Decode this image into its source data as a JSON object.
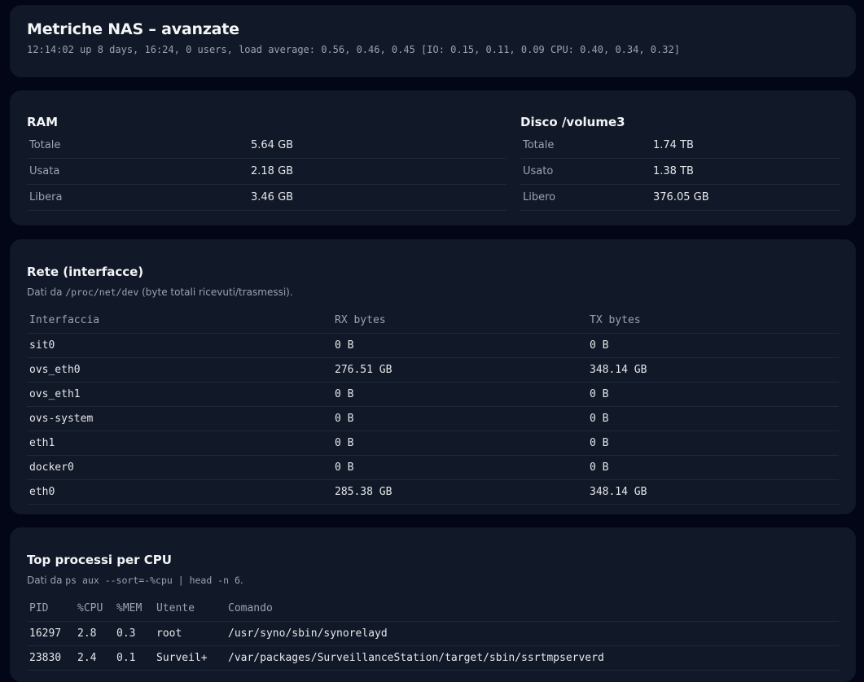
{
  "header": {
    "title": "Metriche NAS – avanzate",
    "uptime": "12:14:02 up 8 days, 16:24, 0 users, load average: 0.56, 0.46, 0.45 [IO: 0.15, 0.11, 0.09 CPU: 0.40, 0.34, 0.32]"
  },
  "ram": {
    "title": "RAM",
    "rows": [
      {
        "label": "Totale",
        "value": "5.64 GB"
      },
      {
        "label": "Usata",
        "value": "2.18 GB"
      },
      {
        "label": "Libera",
        "value": "3.46 GB"
      }
    ]
  },
  "disk": {
    "title": "Disco /volume3",
    "rows": [
      {
        "label": "Totale",
        "value": "1.74 TB"
      },
      {
        "label": "Usato",
        "value": "1.38 TB"
      },
      {
        "label": "Libero",
        "value": "376.05 GB"
      }
    ]
  },
  "network": {
    "title": "Rete (interfacce)",
    "subtitle_prefix": "Dati da",
    "subtitle_code": "/proc/net/dev",
    "subtitle_suffix": "(byte totali ricevuti/trasmessi).",
    "headers": [
      "Interfaccia",
      "RX bytes",
      "TX bytes"
    ],
    "rows": [
      [
        "sit0",
        "0 B",
        "0 B"
      ],
      [
        "ovs_eth0",
        "276.51 GB",
        "348.14 GB"
      ],
      [
        "ovs_eth1",
        "0 B",
        "0 B"
      ],
      [
        "ovs-system",
        "0 B",
        "0 B"
      ],
      [
        "eth1",
        "0 B",
        "0 B"
      ],
      [
        "docker0",
        "0 B",
        "0 B"
      ],
      [
        "eth0",
        "285.38 GB",
        "348.14 GB"
      ]
    ]
  },
  "processes": {
    "title": "Top processi per CPU",
    "subtitle_prefix": "Dati da",
    "subtitle_code": "ps aux --sort=-%cpu | head -n 6",
    "subtitle_suffix": ".",
    "headers": [
      "PID",
      "%CPU",
      "%MEM",
      "Utente",
      "Comando"
    ],
    "rows": [
      [
        "16297",
        "2.8",
        "0.3",
        "root",
        "/usr/syno/sbin/synorelayd"
      ],
      [
        "23830",
        "2.4",
        "0.1",
        "Surveil+",
        "/var/packages/SurveillanceStation/target/sbin/ssrtmpserverd"
      ]
    ]
  }
}
